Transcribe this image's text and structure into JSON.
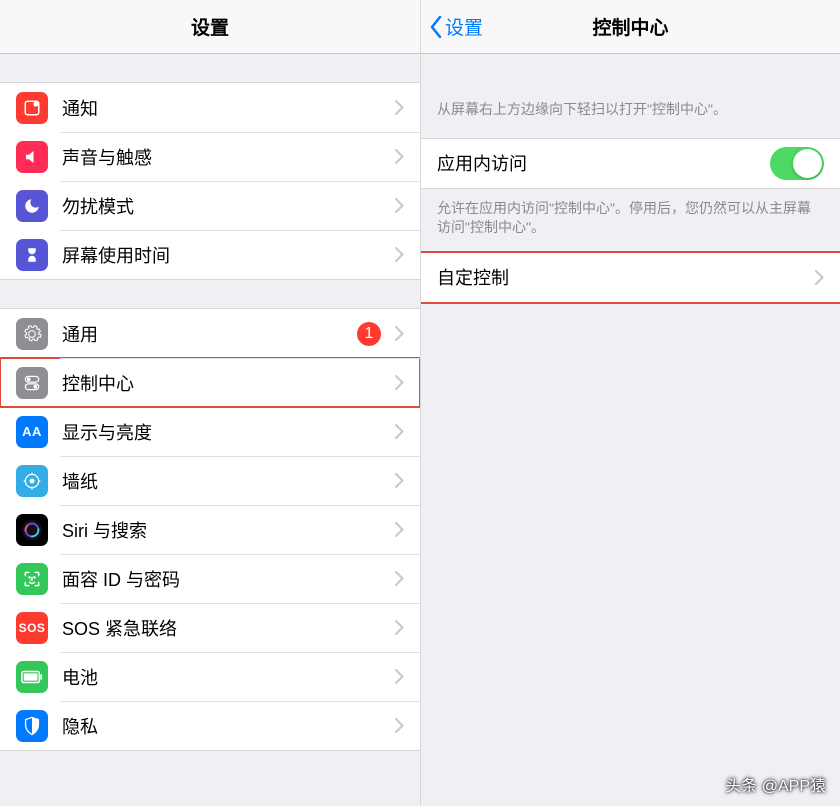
{
  "left": {
    "title": "设置",
    "group1": [
      {
        "label": "通知",
        "iconName": "notification-icon"
      },
      {
        "label": "声音与触感",
        "iconName": "sound-icon"
      },
      {
        "label": "勿扰模式",
        "iconName": "dnd-icon"
      },
      {
        "label": "屏幕使用时间",
        "iconName": "screentime-icon"
      }
    ],
    "group2": [
      {
        "label": "通用",
        "iconName": "general-icon",
        "badge": "1"
      },
      {
        "label": "控制中心",
        "iconName": "control-center-icon",
        "highlight": true
      },
      {
        "label": "显示与亮度",
        "iconName": "display-icon"
      },
      {
        "label": "墙纸",
        "iconName": "wallpaper-icon"
      },
      {
        "label": "Siri 与搜索",
        "iconName": "siri-icon"
      },
      {
        "label": "面容 ID 与密码",
        "iconName": "faceid-icon"
      },
      {
        "label": "SOS 紧急联络",
        "iconName": "sos-icon",
        "iconText": "SOS"
      },
      {
        "label": "电池",
        "iconName": "battery-icon"
      },
      {
        "label": "隐私",
        "iconName": "privacy-icon"
      }
    ]
  },
  "right": {
    "backLabel": "设置",
    "title": "控制中心",
    "note1": "从屏幕右上方边缘向下轻扫以打开\"控制中心\"。",
    "inAppRow": {
      "label": "应用内访问",
      "on": true
    },
    "note2": "允许在应用内访问\"控制中心\"。停用后，您仍然可以从主屏幕访问\"控制中心\"。",
    "customRow": {
      "label": "自定控制",
      "highlight": true
    }
  },
  "watermark": "头条 @APP猿"
}
